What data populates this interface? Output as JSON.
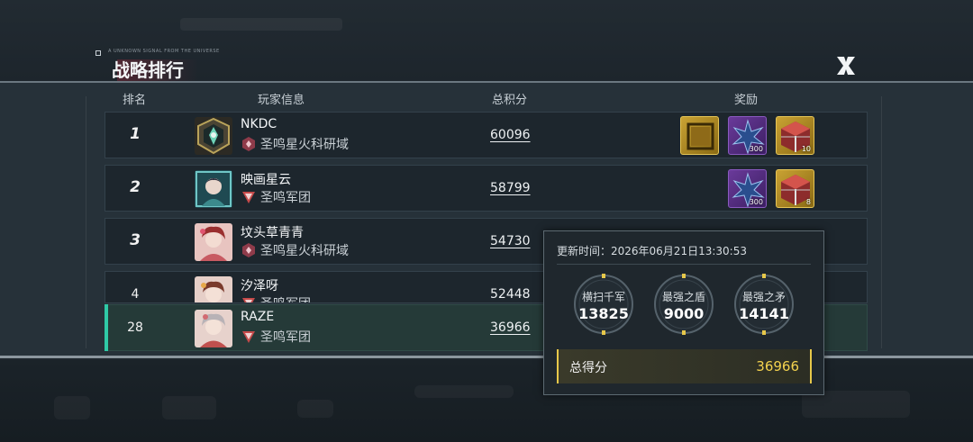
{
  "title_small": "A UNKNOWN SIGNAL FROM THE UNIVERSE",
  "title": "战略排行",
  "headers": {
    "rank": "排名",
    "player": "玩家信息",
    "score": "总积分",
    "reward": "奖励"
  },
  "rows": [
    {
      "rank": "1",
      "name": "NKDC",
      "guild": "圣鸣星火科研域",
      "score": "60096",
      "rewards": [
        {
          "icon": "gold-frame-icon",
          "qty": ""
        },
        {
          "icon": "crystal-icon",
          "qty": "300"
        },
        {
          "icon": "supply-crate-icon",
          "qty": "10"
        }
      ]
    },
    {
      "rank": "2",
      "name": "映画星云",
      "guild": "圣鸣军团",
      "score": "58799",
      "rewards": [
        {
          "icon": "crystal-icon",
          "qty": "300"
        },
        {
          "icon": "supply-crate-icon",
          "qty": "8"
        }
      ]
    },
    {
      "rank": "3",
      "name": "坟头草青青",
      "guild": "圣鸣星火科研域",
      "score": "54730",
      "rewards": []
    },
    {
      "rank": "4",
      "name": "汐泽呀",
      "guild": "圣鸣军团",
      "score": "52448",
      "rewards": []
    },
    {
      "rank": "28",
      "name": "RAZE",
      "guild": "圣鸣军团",
      "score": "36966",
      "rewards": []
    }
  ],
  "popup": {
    "update_time": "更新时间：2026年06月21日13:30:53",
    "stats": [
      {
        "label": "横扫千军",
        "value": "13825"
      },
      {
        "label": "最强之盾",
        "value": "9000"
      },
      {
        "label": "最强之矛",
        "value": "14141"
      }
    ],
    "total_label": "总得分",
    "total_value": "36966"
  },
  "colors": {
    "accent_teal": "#2fc9a6",
    "gold": "#e7c84a",
    "guild_red": "#c64a4a"
  }
}
